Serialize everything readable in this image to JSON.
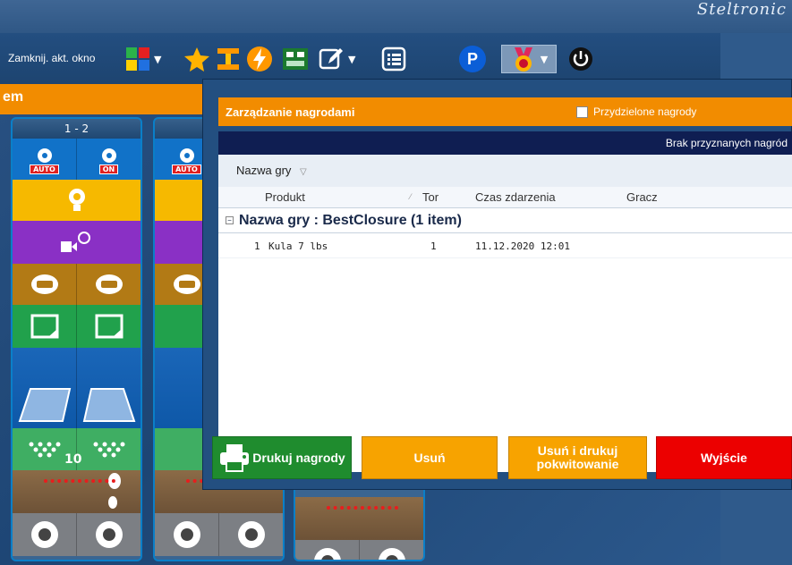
{
  "app": {
    "logo_text": "Steltronic"
  },
  "toolbar": {
    "close_window_label": "Zamknij. akt. okno",
    "items": [
      "color-grid-icon",
      "star-icon",
      "lane-adjust-icon",
      "lightning-icon",
      "scoreboard-icon",
      "edit-icon",
      "list-icon",
      "parking-icon",
      "prize-medal-icon",
      "power-icon"
    ]
  },
  "left": {
    "header_fragment": "em",
    "lane_pair_label": "1 - 2"
  },
  "lanes": {
    "auto_badge": "AUTO",
    "on_badge": "ON",
    "score": "10"
  },
  "dialog": {
    "title": "Zarządzanie nagrodami",
    "assigned_checkbox_label": "Przydzielone nagrody",
    "status_text": "Brak przyznanych nagród",
    "group_panel_label": "Nazwa gry",
    "columns": {
      "product": "Produkt",
      "lane": "Tor",
      "time": "Czas zdarzenia",
      "player": "Gracz"
    },
    "group_label": "Nazwa gry : BestClosure (1 item)",
    "rows": [
      {
        "index": "1",
        "product": "Kula 7 lbs",
        "lane": "1",
        "time": "11.12.2020 12:01",
        "player": ""
      }
    ],
    "buttons": {
      "print": "Drukuj nagrody",
      "delete": "Usuń",
      "delete_print": "Usuń i drukuj pokwitowanie",
      "exit": "Wyjście"
    }
  },
  "colors": {
    "orange": "#f28c00",
    "green_button": "#1f8c2e",
    "red_button": "#ec0000",
    "dark_grid_header": "#0f1e52"
  }
}
